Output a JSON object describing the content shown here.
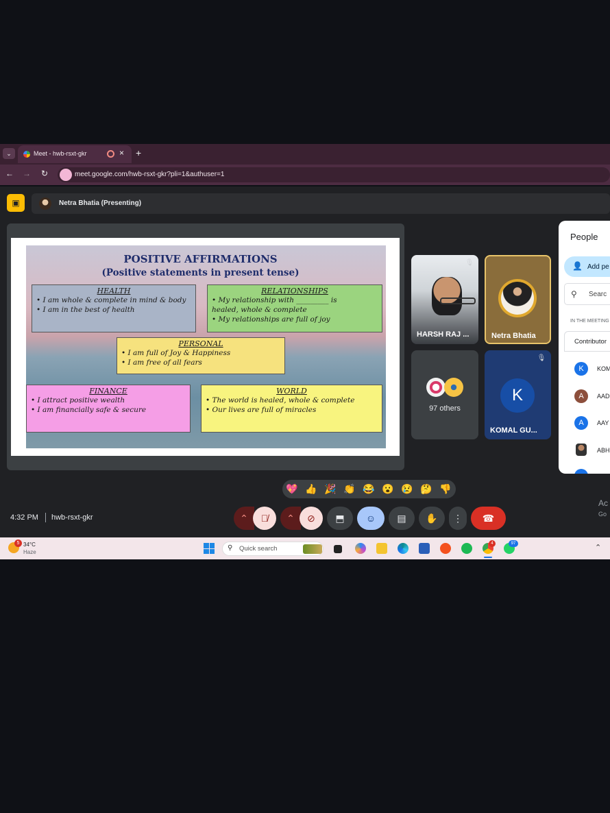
{
  "browser": {
    "tab_title": "Meet - hwb-rsxt-gkr",
    "url": "meet.google.com/hwb-rsxt-gkr?pli=1&authuser=1"
  },
  "presenter_bar": {
    "label": "Netra Bhatia (Presenting)"
  },
  "slide": {
    "title": "POSITIVE AFFIRMATIONS",
    "subtitle": "(Positive statements in present tense)",
    "sections": {
      "health": {
        "heading": "HEALTH",
        "lines": [
          "• I am whole & complete in mind & body",
          "• I am in the best of health"
        ]
      },
      "relationships": {
        "heading": "RELATIONSHIPS",
        "lines": [
          "• My relationship with _________ is",
          "  healed, whole & complete",
          "• My relationships are full of joy"
        ]
      },
      "personal": {
        "heading": "PERSONAL",
        "lines": [
          "• I am full of Joy & Happiness",
          "• I am free of all fears"
        ]
      },
      "finance": {
        "heading": "FINANCE",
        "lines": [
          "• I attract positive wealth",
          "• I am financially safe & secure"
        ]
      },
      "world": {
        "heading": "WORLD",
        "lines": [
          "• The world is healed, whole & complete",
          "• Our lives are full of miracles"
        ]
      }
    },
    "colors": {
      "health": "#a9b4c7",
      "relationships": "#9bd47f",
      "personal": "#f6e27e",
      "finance": "#f59ee6",
      "world": "#f8f47f"
    }
  },
  "participants": {
    "tiles": [
      {
        "name": "HARSH RAJ ..."
      },
      {
        "name": "Netra Bhatia"
      },
      {
        "name": "97 others"
      },
      {
        "name": "KOMAL GU...",
        "initial": "K"
      }
    ]
  },
  "people_panel": {
    "title": "People",
    "add_label": "Add pe",
    "search_placeholder": "Searc",
    "section_label": "IN THE MEETING",
    "group_label": "Contributor",
    "members": [
      {
        "initial": "K",
        "name": "KOM",
        "color": "#1a73e8"
      },
      {
        "initial": "A",
        "name": "AAD",
        "color": "#8d4f3c"
      },
      {
        "initial": "A",
        "name": "AAY",
        "color": "#1a73e8"
      },
      {
        "initial": "",
        "name": "ABH",
        "color": "#5f6368"
      }
    ]
  },
  "reactions": [
    "💖",
    "👍",
    "🎉",
    "👏",
    "😂",
    "😮",
    "😢",
    "🤔",
    "👎"
  ],
  "meeting_info": {
    "time": "4:32 PM",
    "code": "hwb-rsxt-gkr"
  },
  "activate_windows": {
    "line1": "Ac",
    "line2": "Go"
  },
  "taskbar": {
    "weather_temp": "34°C",
    "weather_desc": "Haze",
    "weather_badge": "5",
    "search_placeholder": "Quick search",
    "chrome_badge": "4",
    "whatsapp_badge": "97"
  }
}
